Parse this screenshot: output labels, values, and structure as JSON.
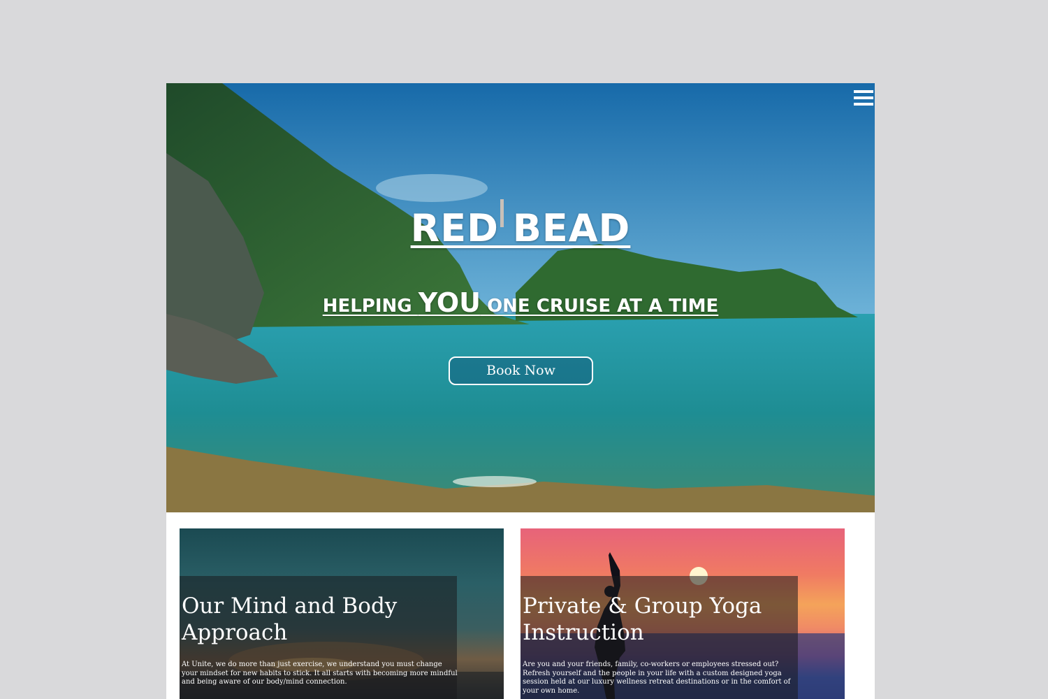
{
  "hero": {
    "title": "RED BEAD",
    "tagline_pre": "HELPING ",
    "tagline_emphasis": "YOU",
    "tagline_post": " ONE CRUISE AT A TIME",
    "cta_label": "Book Now",
    "menu_icon": "hamburger-menu-icon"
  },
  "cards": [
    {
      "title": "Our Mind and Body Approach",
      "text": "At Unite, we do more than just exercise, we understand you must change your mindset for new habits to stick. It all starts with becoming more mindful and being aware of our body/mind connection."
    },
    {
      "title": "Private & Group Yoga Instruction",
      "text": "Are you and your friends, family, co-workers or employees stressed out? Refresh yourself and the people in your life with a custom designed yoga session held at our luxury wellness retreat destinations or in the comfort of your own home."
    }
  ],
  "colors": {
    "page_background": "#d9d9db",
    "sea": "#1b8ea0",
    "sky": "#1a6fb0",
    "button_border": "#ffffff"
  }
}
